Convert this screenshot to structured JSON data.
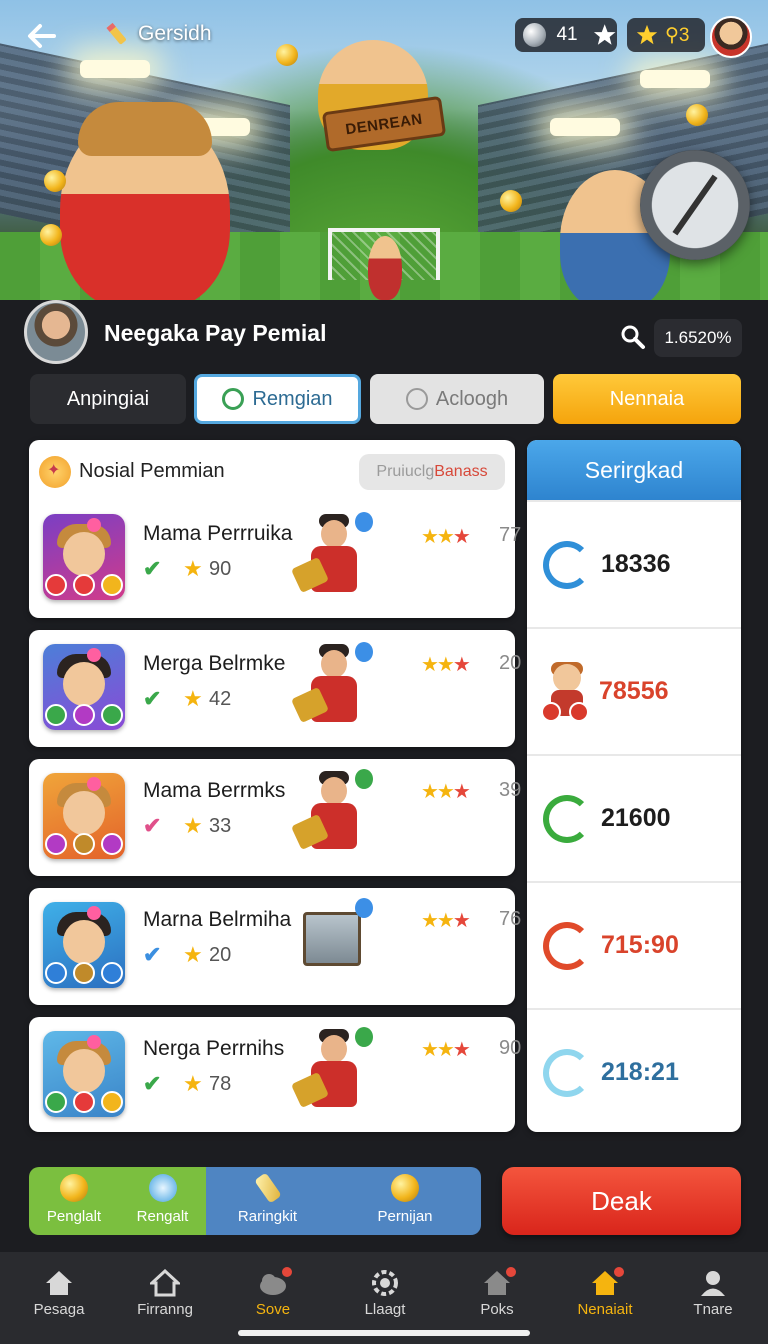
{
  "header": {
    "title": "Gersidh",
    "gems": "41",
    "stars": "⚲3",
    "hero_sign": "DENREAN"
  },
  "profile": {
    "name": "Neegaka Pay Pemial",
    "search_value": "1.6520%"
  },
  "tabs": [
    {
      "label": "Anpingiai"
    },
    {
      "label": "Remgian"
    },
    {
      "label": "Acloogh"
    },
    {
      "label": "Nennaia"
    }
  ],
  "list": {
    "section_title": "Nosial Pemmian",
    "promo_button": {
      "prefix": "Pruiuclg",
      "highlight": " Banass"
    },
    "items": [
      {
        "name": "Mama Perrruika",
        "level": "90",
        "score": "77",
        "check_color": "#3aa84a"
      },
      {
        "name": "Merga Belrmke",
        "level": "42",
        "score": "20",
        "check_color": "#3aa84a"
      },
      {
        "name": "Mama Berrmks",
        "level": "33",
        "score": "39",
        "check_color": "#e0508a"
      },
      {
        "name": "Marna Belrmiha",
        "level": "20",
        "score": "76",
        "check_color": "#3b8fe0"
      },
      {
        "name": "Nerga Perrnihs",
        "level": "78",
        "score": "90",
        "check_color": "#3aa84a"
      }
    ]
  },
  "stats": {
    "title": "Serirgkad",
    "rows": [
      {
        "value": "18336",
        "color": "#1d1d1d",
        "icon_color": "#2f8fd8"
      },
      {
        "value": "78556",
        "color": "#d9432b",
        "icon_color": "hero"
      },
      {
        "value": "21600",
        "color": "#1d1d1d",
        "icon_color": "#3aab3d"
      },
      {
        "value": "715:90",
        "color": "#d9432b",
        "icon_color": "#e04a2a"
      },
      {
        "value": "218:21",
        "color": "#2e6f9e",
        "icon_color": "#8fd6ee"
      }
    ]
  },
  "actions": [
    {
      "label": "Penglalt"
    },
    {
      "label": "Rengalt"
    },
    {
      "label": "Raringkit"
    },
    {
      "label": "Pernijan"
    }
  ],
  "deal_button": "Deak",
  "nav": [
    {
      "label": "Pesaga",
      "icon": "home-icon"
    },
    {
      "label": "Firranng",
      "icon": "house-icon"
    },
    {
      "label": "Sove",
      "icon": "cloud-icon",
      "active": true
    },
    {
      "label": "Llaagt",
      "icon": "gear-icon"
    },
    {
      "label": "Poks",
      "icon": "house-badge-icon"
    },
    {
      "label": "Nenaiait",
      "icon": "shop-icon",
      "active": true
    },
    {
      "label": "Tnare",
      "icon": "person-icon"
    }
  ],
  "colors": {
    "accent_yellow": "#f5b40f",
    "accent_red": "#e5473a",
    "accent_blue": "#2e84cf",
    "green": "#7bbf3f"
  }
}
